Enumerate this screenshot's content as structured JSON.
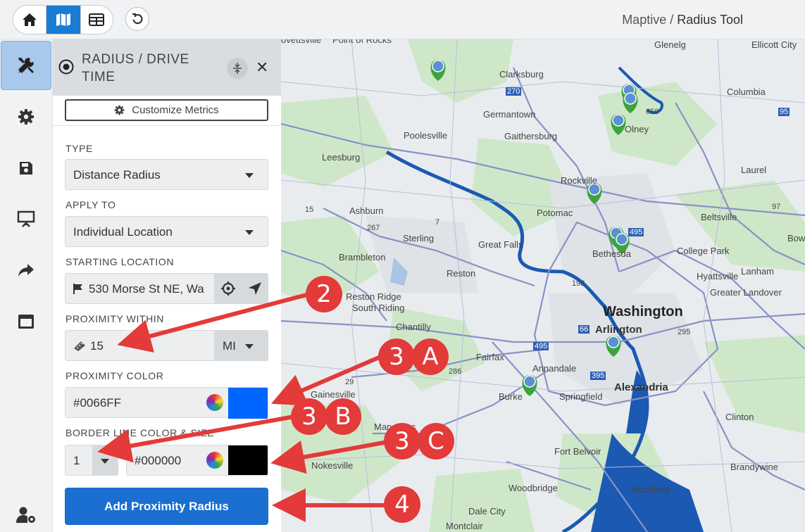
{
  "header": {
    "app_name": "Maptive",
    "separator": "/",
    "page_name": "Radius Tool",
    "nav_buttons": [
      "home-icon",
      "map-icon",
      "table-icon"
    ],
    "undo_icon": "undo-icon"
  },
  "rail": {
    "items": [
      "tools-icon",
      "gear-icon",
      "save-icon",
      "presentation-icon",
      "share-icon",
      "window-icon",
      "user-settings-icon"
    ]
  },
  "panel": {
    "title": "RADIUS / DRIVE TIME",
    "metrics_button": "Customize Metrics",
    "type_label": "TYPE",
    "type_value": "Distance Radius",
    "apply_label": "APPLY TO",
    "apply_value": "Individual Location",
    "start_label": "STARTING LOCATION",
    "start_value": "530 Morse St NE, Wa",
    "proximity_label": "PROXIMITY WITHIN",
    "proximity_value": "15",
    "proximity_unit": "MI",
    "color_label": "PROXIMITY COLOR",
    "color_value": "#0066FF",
    "color_swatch": "#0066ff",
    "border_label": "BORDER LINE COLOR & SIZE",
    "border_size": "1",
    "border_color": "#000000",
    "border_swatch": "#000000",
    "add_button": "Add Proximity Radius"
  },
  "map": {
    "labels": [
      "ovettsville",
      "Point of Rocks",
      "Glenelg",
      "Ellicott City",
      "Clarksburg",
      "270",
      "Columbia",
      "Germantown",
      "650",
      "Poolesville",
      "Gaithersburg",
      "Olney",
      "Leesburg",
      "Laurel",
      "95",
      "Rockville",
      "Potomac",
      "Beltsville",
      "Ashburn",
      "267",
      "7",
      "15",
      "Sterling",
      "Great Falls",
      "College Park",
      "Bethesda",
      "495",
      "Brambleton",
      "Reston",
      "193",
      "Hyattsville",
      "Lanham",
      "Greater Landover",
      "Reston Ridge",
      "South Riding",
      "Washington",
      "Chantilly",
      "Arlington",
      "295",
      "66",
      "Fairfax",
      "495",
      "Annandale",
      "286",
      "Chantilly",
      "Springfield",
      "Alexandria",
      "Burke",
      "Gainesville",
      "29",
      "395",
      "Manassas",
      "Clinton",
      "Fort Belvoir",
      "Brandywine",
      "Nokesville",
      "Woodbridge",
      "Accokeek",
      "Dale City",
      "Montclair",
      "Bowie",
      "97"
    ],
    "pin_color": "#3ba53b"
  },
  "callouts": [
    "2",
    "3",
    "A",
    "3",
    "B",
    "3",
    "C",
    "4"
  ],
  "accent_color": "#e33a3a"
}
